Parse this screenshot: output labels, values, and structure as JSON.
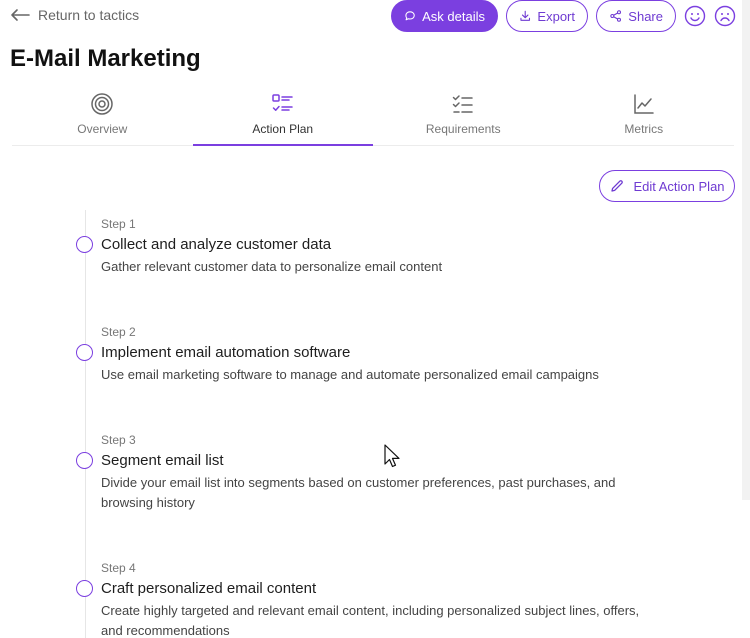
{
  "nav": {
    "back_label": "Return to tactics"
  },
  "header_actions": {
    "ask_label": "Ask details",
    "export_label": "Export",
    "share_label": "Share"
  },
  "page": {
    "title": "E-Mail Marketing"
  },
  "tabs": [
    {
      "label": "Overview",
      "icon": "target-icon"
    },
    {
      "label": "Action Plan",
      "icon": "checklist-icon",
      "active": true
    },
    {
      "label": "Requirements",
      "icon": "requirements-icon"
    },
    {
      "label": "Metrics",
      "icon": "chart-icon"
    }
  ],
  "edit": {
    "label": "Edit Action Plan"
  },
  "steps": [
    {
      "label": "Step 1",
      "title": "Collect and analyze customer data",
      "desc": "Gather relevant customer data to personalize email content"
    },
    {
      "label": "Step 2",
      "title": "Implement email automation software",
      "desc": "Use email marketing software to manage and automate personalized email campaigns"
    },
    {
      "label": "Step 3",
      "title": "Segment email list",
      "desc": "Divide your email list into segments based on customer preferences, past purchases, and browsing history"
    },
    {
      "label": "Step 4",
      "title": "Craft personalized email content",
      "desc": "Create highly targeted and relevant email content, including personalized subject lines, offers, and recommendations"
    }
  ],
  "colors": {
    "accent": "#7b3fe0"
  }
}
